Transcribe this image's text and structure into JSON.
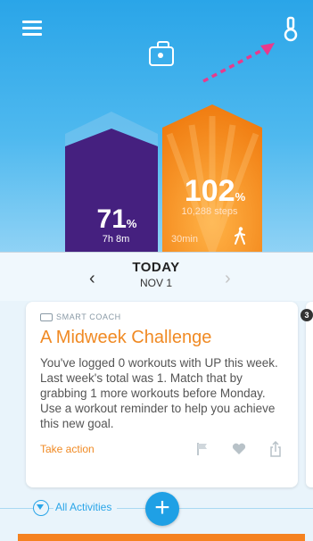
{
  "header": {
    "menu_icon": "hamburger-menu-icon",
    "camera_icon": "camera-icon",
    "band_icon": "wristband-icon"
  },
  "annotation": {
    "arrow_color": "#e83a8c"
  },
  "colors": {
    "sleep_bar": "#45207f",
    "steps_bar": "#f58220",
    "accent": "#f08a24",
    "blue": "#2aa5e8"
  },
  "progress": {
    "sleep": {
      "percent": "71",
      "unit": "%",
      "duration": "7h 8m",
      "goal_fraction": 0.71
    },
    "steps": {
      "percent": "102",
      "unit": "%",
      "steps_text": "10,288 steps",
      "active_time": "30min",
      "goal_fraction": 1.02
    }
  },
  "date_nav": {
    "title": "TODAY",
    "date": "NOV 1",
    "prev": "‹",
    "next": "›"
  },
  "card": {
    "label": "SMART COACH",
    "title": "A Midweek Challenge",
    "body": "You've logged 0 workouts with UP this week. Last week's total was 1. Match that by grabbing 1 more workouts before Monday. Use a workout reminder to help you achieve this new goal.",
    "action": "Take action",
    "icons": [
      "flag-icon",
      "heart-icon",
      "share-icon"
    ],
    "counter": "3"
  },
  "filter": {
    "label": "All Activities",
    "icon": "filter-icon"
  },
  "add_button": {
    "label": "+"
  }
}
